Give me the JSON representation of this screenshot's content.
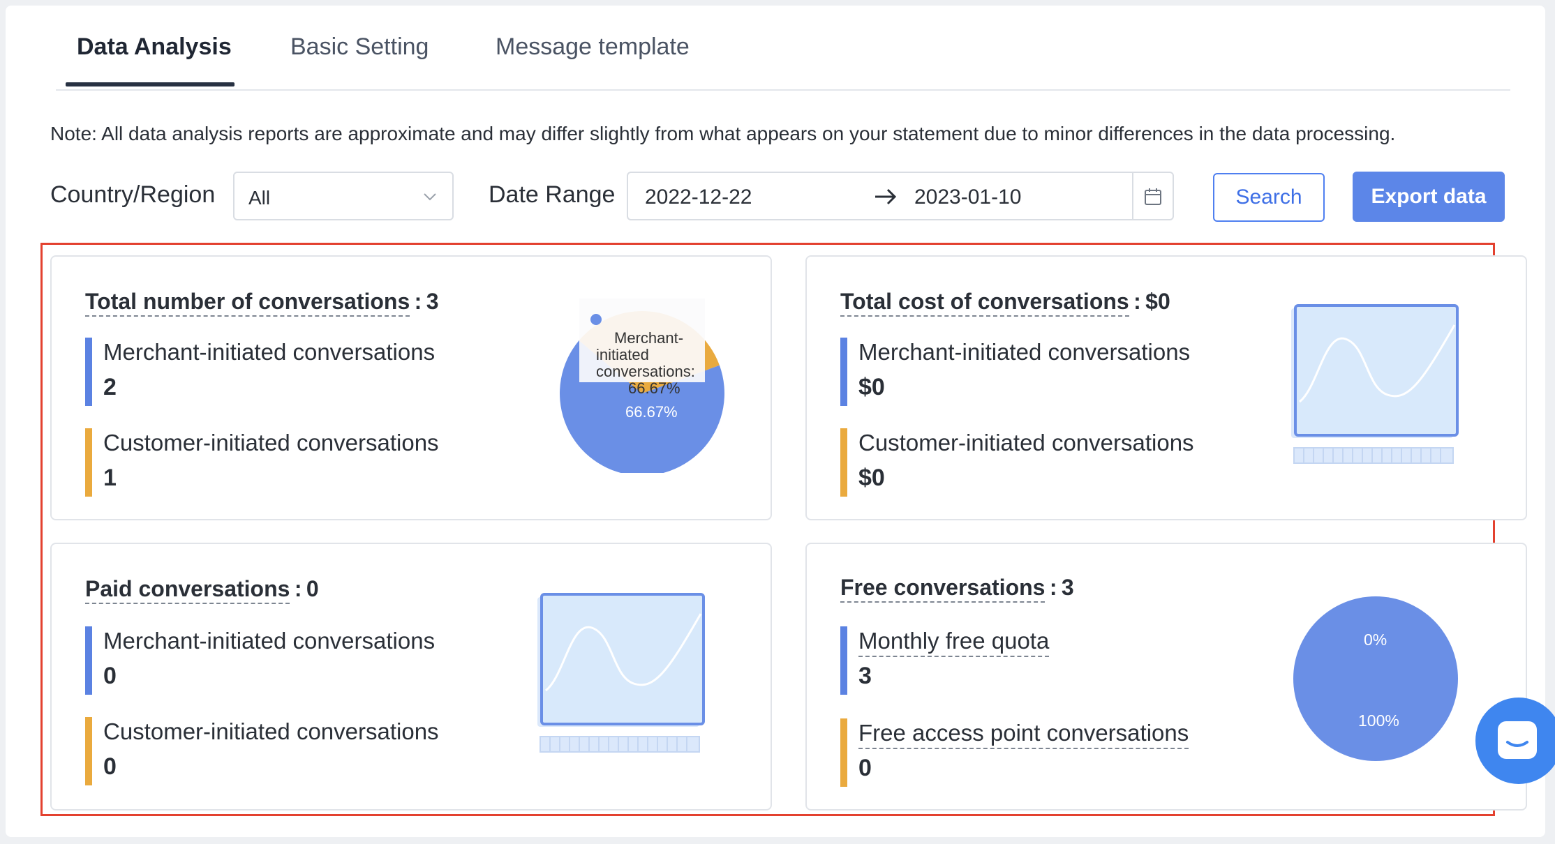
{
  "tabs": [
    {
      "label": "Data Analysis",
      "active": true
    },
    {
      "label": "Basic Setting",
      "active": false
    },
    {
      "label": "Message template",
      "active": false
    }
  ],
  "note": "Note: All data analysis reports are approximate and may differ slightly from what appears on your statement due to minor differences in the data processing.",
  "filters": {
    "country_label": "Country/Region",
    "country_value": "All",
    "date_label": "Date Range",
    "date_start": "2022-12-22",
    "date_end": "2023-01-10",
    "search_label": "Search",
    "export_label": "Export data"
  },
  "colors": {
    "accent": "#5c86e8",
    "blue_bar": "#5b82e2",
    "orange_bar": "#eaaa3e",
    "highlight": "#e3412f"
  },
  "cards": {
    "total": {
      "title": "Total number of conversations",
      "value": "3",
      "m1_label": "Merchant-initiated conversations",
      "m1_value": "2",
      "m2_label": "Customer-initiated conversations",
      "m2_value": "1",
      "tooltip_line1": "Merchant-",
      "tooltip_line2": "initiated",
      "tooltip_line3": "conversations:",
      "tooltip_line4": "66.67%",
      "slice_label": "66.67%"
    },
    "cost": {
      "title": "Total cost of conversations",
      "value": "$0",
      "m1_label": "Merchant-initiated conversations",
      "m1_value": "$0",
      "m2_label": "Customer-initiated conversations",
      "m2_value": "$0"
    },
    "paid": {
      "title": "Paid conversations",
      "value": "0",
      "m1_label": "Merchant-initiated conversations",
      "m1_value": "0",
      "m2_label": "Customer-initiated conversations",
      "m2_value": "0"
    },
    "free": {
      "title": "Free conversations",
      "value": "3",
      "m1_label": "Monthly free quota",
      "m1_value": "3",
      "m2_label": "Free access point conversations",
      "m2_value": "0",
      "pie_top_label": "0%",
      "pie_bottom_label": "100%"
    }
  },
  "chart_data": [
    {
      "type": "pie",
      "title": "",
      "categories": [
        "Merchant-initiated conversations",
        "Customer-initiated conversations"
      ],
      "values": [
        2,
        1
      ],
      "colors": [
        "#6a8fe6",
        "#e9aa3f"
      ],
      "highlighted_category": "Merchant-initiated conversations"
    },
    {
      "type": "pie",
      "title": "",
      "categories": [
        "Monthly free quota",
        "Free access point conversations"
      ],
      "values": [
        3,
        0
      ],
      "colors": [
        "#6a8fe6",
        "#e9aa3f"
      ]
    }
  ]
}
